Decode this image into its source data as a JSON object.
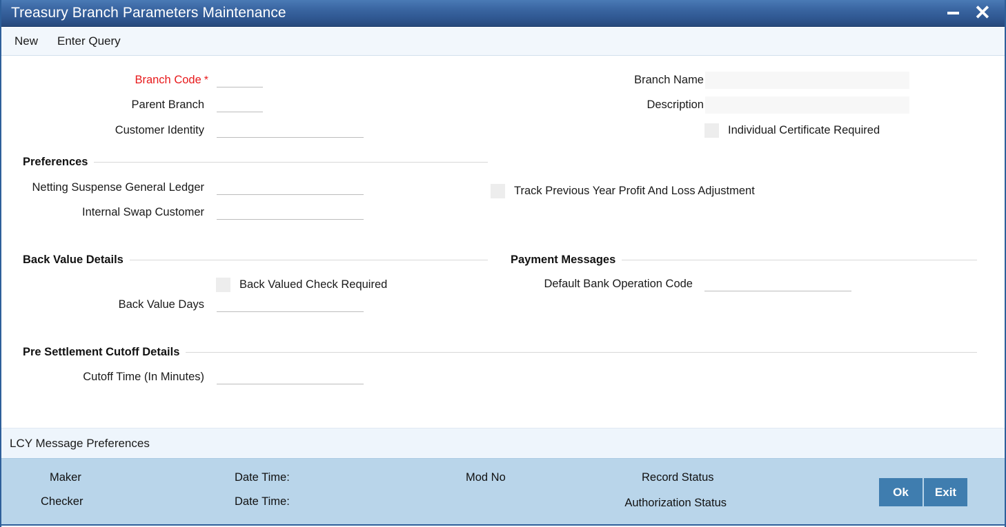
{
  "window": {
    "title": "Treasury Branch Parameters Maintenance",
    "minimize_icon": "minimize-icon",
    "close_icon": "close-icon"
  },
  "toolbar": {
    "new_label": "New",
    "enter_query_label": "Enter Query"
  },
  "form": {
    "branch_code": {
      "label": "Branch Code",
      "required_marker": "*",
      "value": ""
    },
    "parent_branch": {
      "label": "Parent Branch",
      "value": ""
    },
    "customer_identity": {
      "label": "Customer Identity",
      "value": ""
    },
    "branch_name": {
      "label": "Branch Name",
      "value": ""
    },
    "description": {
      "label": "Description",
      "value": ""
    },
    "individual_certificate_required": {
      "label": "Individual Certificate Required",
      "checked": false
    }
  },
  "preferences": {
    "section_title": "Preferences",
    "netting_suspense_general_ledger": {
      "label": "Netting Suspense General Ledger",
      "value": ""
    },
    "internal_swap_customer": {
      "label": "Internal Swap Customer",
      "value": ""
    },
    "track_previous_year_profit_and_loss_adjustment": {
      "label": "Track Previous Year Profit And Loss Adjustment",
      "checked": false
    }
  },
  "back_value_details": {
    "section_title": "Back Value Details",
    "back_valued_check_required": {
      "label": "Back Valued Check Required",
      "checked": false
    },
    "back_value_days": {
      "label": "Back Value Days",
      "value": ""
    }
  },
  "payment_messages": {
    "section_title": "Payment Messages",
    "default_bank_operation_code": {
      "label": "Default Bank Operation Code",
      "value": ""
    }
  },
  "pre_settlement_cutoff_details": {
    "section_title": "Pre Settlement Cutoff Details",
    "cutoff_time": {
      "label": "Cutoff Time (In Minutes)",
      "value": ""
    }
  },
  "lcy_message_preferences": {
    "label": "LCY Message Preferences"
  },
  "footer": {
    "maker_label": "Maker",
    "checker_label": "Checker",
    "maker_date_time_label": "Date Time:",
    "checker_date_time_label": "Date Time:",
    "mod_no_label": "Mod No",
    "record_status_label": "Record Status",
    "authorization_status_label": "Authorization Status",
    "ok_label": "Ok",
    "exit_label": "Exit"
  },
  "colors": {
    "titlebar_start": "#4a7ab5",
    "titlebar_end": "#27497c",
    "accent_border": "#2e5f9a",
    "required_red": "#e8191b",
    "footer_bg": "#b9d5ea",
    "button_bg": "#3f7daf",
    "lcy_bar_bg": "#eef5fc",
    "toolbar_bg": "#f2f7fc"
  }
}
